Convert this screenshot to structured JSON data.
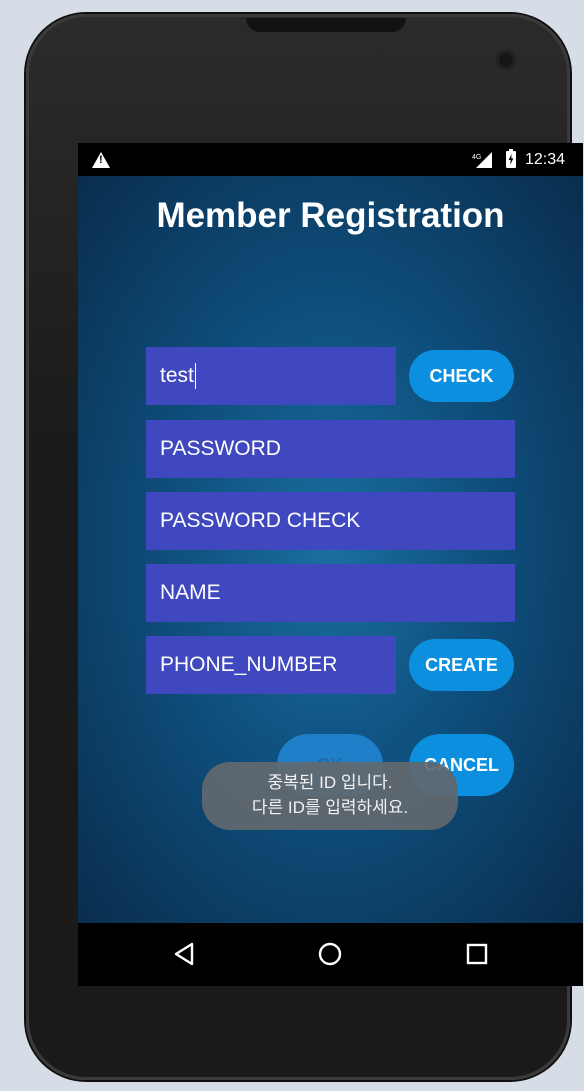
{
  "statusbar": {
    "network_label": "4G",
    "time": "12:34"
  },
  "app": {
    "title": "Member Registration",
    "id_field": {
      "value": "test"
    },
    "check_button": "CHECK",
    "password_field": {
      "placeholder": "PASSWORD"
    },
    "password_check_field": {
      "placeholder": "PASSWORD CHECK"
    },
    "name_field": {
      "placeholder": "NAME"
    },
    "phone_field": {
      "placeholder": "PHONE_NUMBER"
    },
    "create_button": "CREATE",
    "ok_button": "OK",
    "cancel_button": "CANCEL"
  },
  "toast": {
    "line1": "중복된 ID 입니다.",
    "line2": "다른 ID를 입력하세요."
  },
  "navbar": {
    "icons": [
      "back-icon",
      "home-icon",
      "recents-icon"
    ]
  },
  "colors": {
    "field_bg": "#3f48bf",
    "button_bg": "#0c8fde",
    "toast_bg": "#62686e"
  }
}
